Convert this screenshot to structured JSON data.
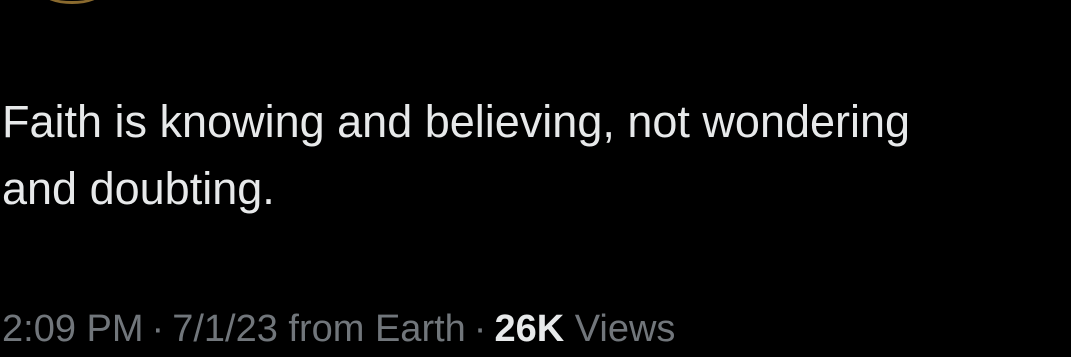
{
  "tweet": {
    "text_lines": [
      "Faith is knowing and believing, not wondering",
      "and doubting."
    ],
    "time": "2:09 PM",
    "date": "7/1/23",
    "source": "from Earth",
    "separator": "·",
    "views_count": "26K",
    "views_label": "Views"
  },
  "colors": {
    "background": "#000000",
    "text": "#e7e9ea",
    "meta": "#71767b",
    "avatar_ring": "#8a6a2e"
  }
}
